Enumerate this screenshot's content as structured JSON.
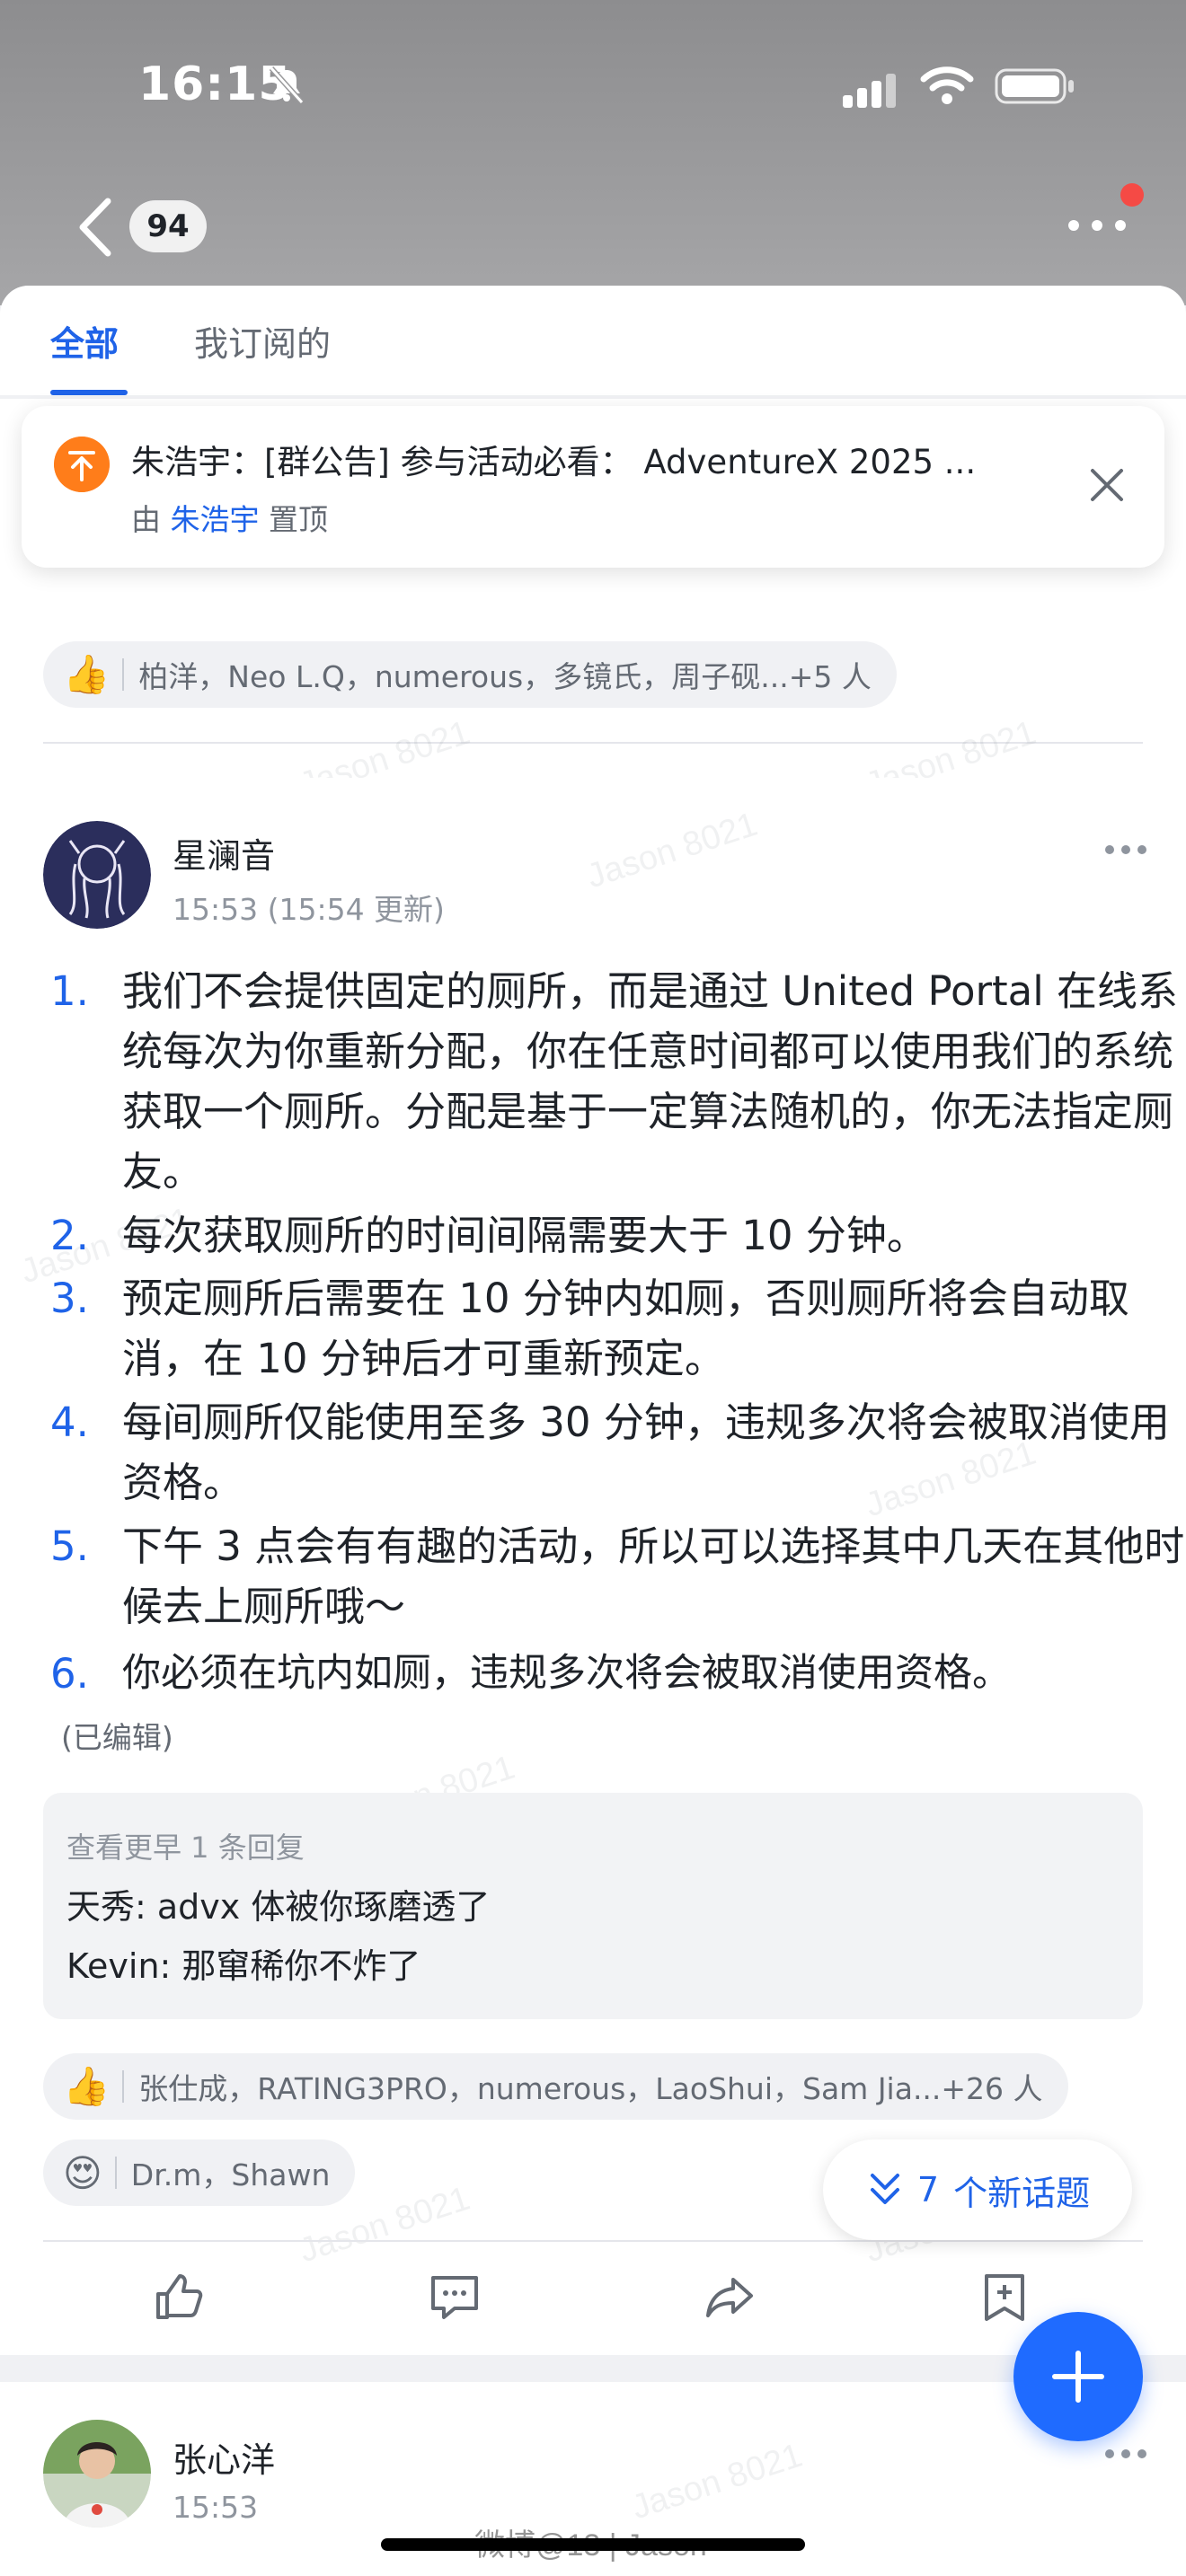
{
  "status_bar": {
    "time": "16:15"
  },
  "nav": {
    "back_count": "94"
  },
  "tabs": [
    {
      "label": "全部",
      "active": true
    },
    {
      "label": "我订阅的",
      "active": false
    }
  ],
  "pinned": {
    "title": "朱浩宇：[群公告] 参与活动必看： AdventureX 2025 ...",
    "by_prefix": "由",
    "by_name": "朱浩宇",
    "by_suffix": "置顶"
  },
  "prev_post": {
    "reactions": "柏洋，Neo L.Q，numerous，多镜氏，周子砚...+5 人"
  },
  "post": {
    "author": "星澜音",
    "time": "15:53 (15:54 更新)",
    "items": [
      {
        "num": "1.",
        "text": "我们不会提供固定的厕所，而是通过 United Portal 在线系统每次为你重新分配，你在任意时间都可以使用我们的系统获取一个厕所。分配是基于一定算法随机的，你无法指定厕友。"
      },
      {
        "num": "2.",
        "text": "每次获取厕所的时间间隔需要大于 10 分钟。"
      },
      {
        "num": "3.",
        "text": "预定厕所后需要在 10 分钟内如厕，否则厕所将会自动取消，在 10 分钟后才可重新预定。"
      },
      {
        "num": "4.",
        "text": "每间厕所仅能使用至多 30 分钟，违规多次将会被取消使用资格。"
      },
      {
        "num": "5.",
        "text": "下午 3 点会有有趣的活动，所以可以选择其中几天在其他时候去上厕所哦～"
      },
      {
        "num": "6.",
        "text": "你必须在坑内如厕，违规多次将会被取消使用资格。"
      }
    ],
    "edited": "(已编辑)",
    "replies": {
      "more": "查看更早 1 条回复",
      "lines": [
        "天秀: advx 体被你琢磨透了",
        "Kevin: 那窜稀你不炸了"
      ]
    },
    "reactions": [
      {
        "emoji": "👍",
        "names": "张仕成，RATING3PRO，numerous，LaoShui，Sam Jia...+26 人"
      },
      {
        "emoji": "😍",
        "names": "Dr.m，Shawn"
      }
    ]
  },
  "new_topics": {
    "count": "7",
    "label": "个新话题"
  },
  "next_post": {
    "author": "张心洋",
    "time": "15:53"
  },
  "watermark": "Jason 8021",
  "weibo_watermark": "微博@13 | Jason",
  "colors": {
    "accent": "#1f63e8",
    "pin": "#ff7d1a",
    "badge": "#f54a45",
    "fab": "#1f6bff"
  },
  "icons": [
    "back-arrow-icon",
    "more-dots-icon",
    "pin-icon",
    "close-icon",
    "thumbs-up-icon",
    "comment-icon",
    "share-icon",
    "bookmark-icon",
    "double-chevron-down-icon",
    "plus-icon"
  ]
}
